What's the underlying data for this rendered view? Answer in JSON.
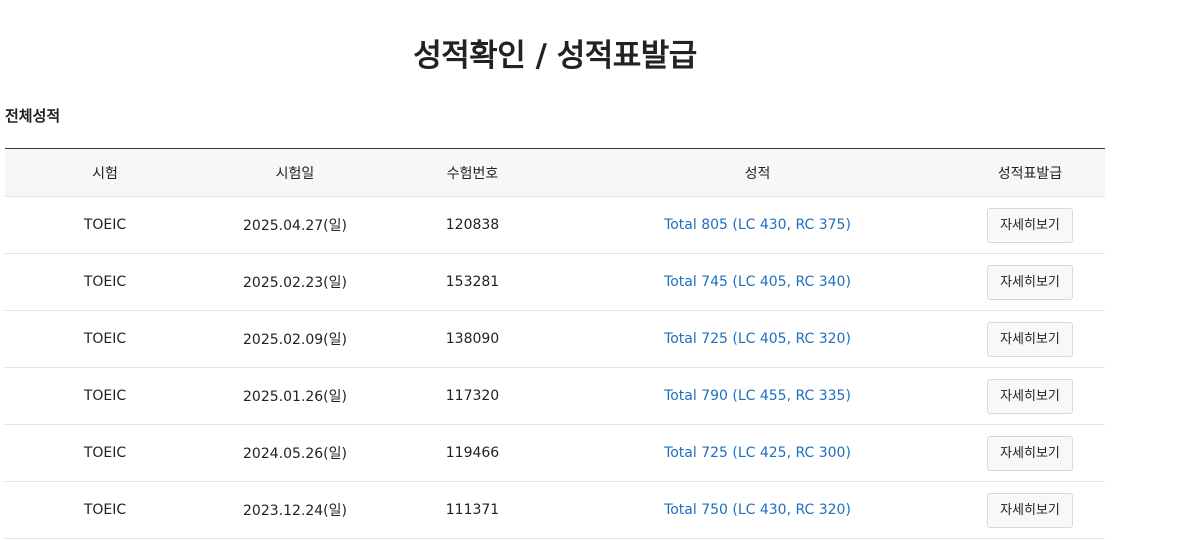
{
  "page": {
    "title": "성적확인 / 성적표발급"
  },
  "section": {
    "title": "전체성적"
  },
  "table": {
    "headers": [
      "시험",
      "시험일",
      "수험번호",
      "성적",
      "성적표발급"
    ],
    "rows": [
      {
        "exam": "TOEIC",
        "date": "2025.04.27(일)",
        "number": "120838",
        "score": "Total 805 (LC 430, RC 375)",
        "action": "자세히보기"
      },
      {
        "exam": "TOEIC",
        "date": "2025.02.23(일)",
        "number": "153281",
        "score": "Total 745 (LC 405, RC 340)",
        "action": "자세히보기"
      },
      {
        "exam": "TOEIC",
        "date": "2025.02.09(일)",
        "number": "138090",
        "score": "Total 725 (LC 405, RC 320)",
        "action": "자세히보기"
      },
      {
        "exam": "TOEIC",
        "date": "2025.01.26(일)",
        "number": "117320",
        "score": "Total 790 (LC 455, RC 335)",
        "action": "자세히보기"
      },
      {
        "exam": "TOEIC",
        "date": "2024.05.26(일)",
        "number": "119466",
        "score": "Total 725 (LC 425, RC 300)",
        "action": "자세히보기"
      },
      {
        "exam": "TOEIC",
        "date": "2023.12.24(일)",
        "number": "111371",
        "score": "Total 750 (LC 430, RC 320)",
        "action": "자세히보기"
      }
    ]
  },
  "colors": {
    "link": "#1f6fbf",
    "header_bg": "#f7f7f7",
    "top_border": "#333333"
  }
}
